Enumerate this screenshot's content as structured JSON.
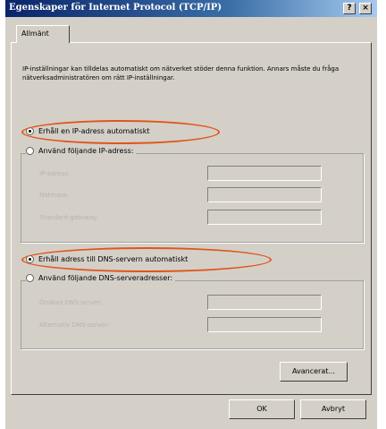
{
  "window": {
    "title": "Egenskaper för Internet Protocol (TCP/IP)",
    "help_label": "?",
    "close_label": "×"
  },
  "tabs": [
    {
      "label": "Allmänt"
    }
  ],
  "intro": "IP-inställningar kan tilldelas automatiskt om nätverket stöder denna funktion. Annars måste du fråga nätverksadministratören om rätt IP-inställningar.",
  "ip": {
    "auto_label": "Erhåll en IP-adress automatiskt",
    "auto_checked": true,
    "manual_label": "Använd följande IP-adress:",
    "fields": [
      {
        "label": "IP-adress:"
      },
      {
        "label": "Nätmask:"
      },
      {
        "label": "Standard-gateway:"
      }
    ]
  },
  "dns": {
    "auto_label": "Erhåll adress till DNS-servern automatiskt",
    "auto_checked": true,
    "manual_label": "Använd följande DNS-serveradresser:",
    "fields": [
      {
        "label": "Önskad DNS-server:"
      },
      {
        "label": "Alternativ DNS-server:"
      }
    ]
  },
  "buttons": {
    "advanced": "Avancerat...",
    "ok": "OK",
    "cancel": "Avbryt"
  },
  "colors": {
    "titlebar": "#0a246a",
    "highlight_oval": "#e0561c"
  }
}
